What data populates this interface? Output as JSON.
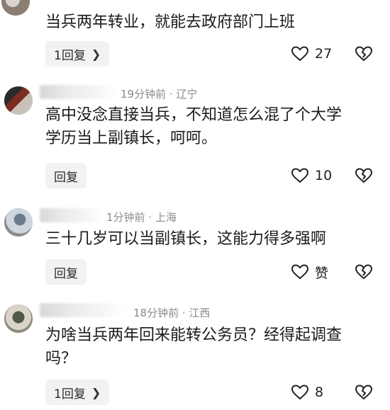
{
  "comments": [
    {
      "text": "当兵两年转业，就能去政府部门上班",
      "reply_label": "1回复",
      "like_count": "27"
    },
    {
      "time": "19分钟前",
      "location": "辽宁",
      "text": "高中没念直接当兵，不知道怎么混了个大学\n学历当上副镇长，呵呵。",
      "reply_label": "回复",
      "like_count": "10"
    },
    {
      "time": "1分钟前",
      "location": "上海",
      "text": "三十几岁可以当副镇长，这能力得多强啊",
      "reply_label": "回复",
      "like_count": "赞"
    },
    {
      "time": "18分钟前",
      "location": "江西",
      "text": "为啥当兵两年回来能转公务员？经得起调查\n吗？",
      "reply_label": "1回复",
      "like_count": "8"
    }
  ],
  "separator": " · ",
  "icons": {
    "like": "heart-outline-icon",
    "dislike": "broken-heart-icon",
    "reply_more": "chevron-right-icon"
  }
}
